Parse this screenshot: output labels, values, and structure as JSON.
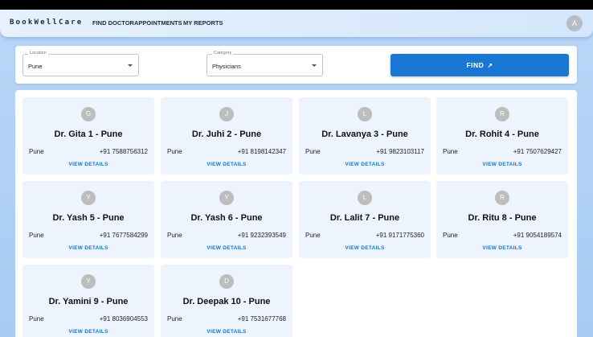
{
  "app": {
    "brand": "BookWellCare",
    "nav": [
      "FIND DOCTOR",
      "APPOINTMENTS",
      "MY REPORTS"
    ],
    "user_initial": "A"
  },
  "search": {
    "location_label": "Location",
    "location_value": "Pune",
    "category_label": "Category",
    "category_value": "Physicians",
    "find_label": "FIND",
    "find_icon": "north-east-arrow-icon"
  },
  "doctors": [
    {
      "initial": "G",
      "name": "Dr. Gita 1 - Pune",
      "city": "Pune",
      "phone": "+91 7588756312",
      "action": "VIEW DETAILS"
    },
    {
      "initial": "J",
      "name": "Dr. Juhi 2 - Pune",
      "city": "Pune",
      "phone": "+91 8198142347",
      "action": "VIEW DETAILS"
    },
    {
      "initial": "L",
      "name": "Dr. Lavanya 3 - Pune",
      "city": "Pune",
      "phone": "+91 9823103117",
      "action": "VIEW DETAILS"
    },
    {
      "initial": "R",
      "name": "Dr. Rohit 4 - Pune",
      "city": "Pune",
      "phone": "+91 7507629427",
      "action": "VIEW DETAILS"
    },
    {
      "initial": "Y",
      "name": "Dr. Yash 5 - Pune",
      "city": "Pune",
      "phone": "+91 7677584299",
      "action": "VIEW DETAILS"
    },
    {
      "initial": "Y",
      "name": "Dr. Yash 6 - Pune",
      "city": "Pune",
      "phone": "+91 9232393549",
      "action": "VIEW DETAILS"
    },
    {
      "initial": "L",
      "name": "Dr. Lalit 7 - Pune",
      "city": "Pune",
      "phone": "+91 9171775360",
      "action": "VIEW DETAILS"
    },
    {
      "initial": "R",
      "name": "Dr. Ritu 8 - Pune",
      "city": "Pune",
      "phone": "+91 9054189574",
      "action": "VIEW DETAILS"
    },
    {
      "initial": "Y",
      "name": "Dr. Yamini 9 - Pune",
      "city": "Pune",
      "phone": "+91 8036904553",
      "action": "VIEW DETAILS"
    },
    {
      "initial": "D",
      "name": "Dr. Deepak 10 - Pune",
      "city": "Pune",
      "phone": "+91 7531677768",
      "action": "VIEW DETAILS"
    }
  ],
  "colors": {
    "primary": "#1976d2",
    "card_bg": "#edf4fd",
    "page_bg": "#b9d7f8"
  }
}
